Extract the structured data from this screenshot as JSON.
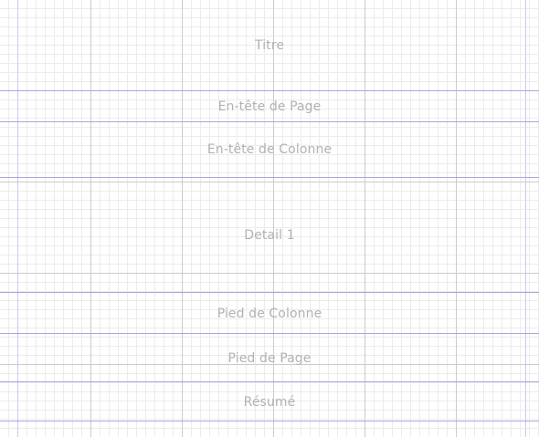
{
  "report_bands": [
    {
      "id": "title",
      "label": "Titre"
    },
    {
      "id": "page-header",
      "label": "En-tête de Page"
    },
    {
      "id": "column-header",
      "label": "En-tête de Colonne"
    },
    {
      "id": "detail-1",
      "label": "Detail 1"
    },
    {
      "id": "column-footer",
      "label": "Pied de Colonne"
    },
    {
      "id": "page-footer",
      "label": "Pied de Page"
    },
    {
      "id": "summary",
      "label": "Résumé"
    }
  ],
  "colors": {
    "band_separator": "#a8a8e0",
    "margin_guide": "#c8c8f0",
    "grid_major": "#cccccc",
    "grid_minor": "#ececec",
    "band_label": "#b2b2b2"
  }
}
